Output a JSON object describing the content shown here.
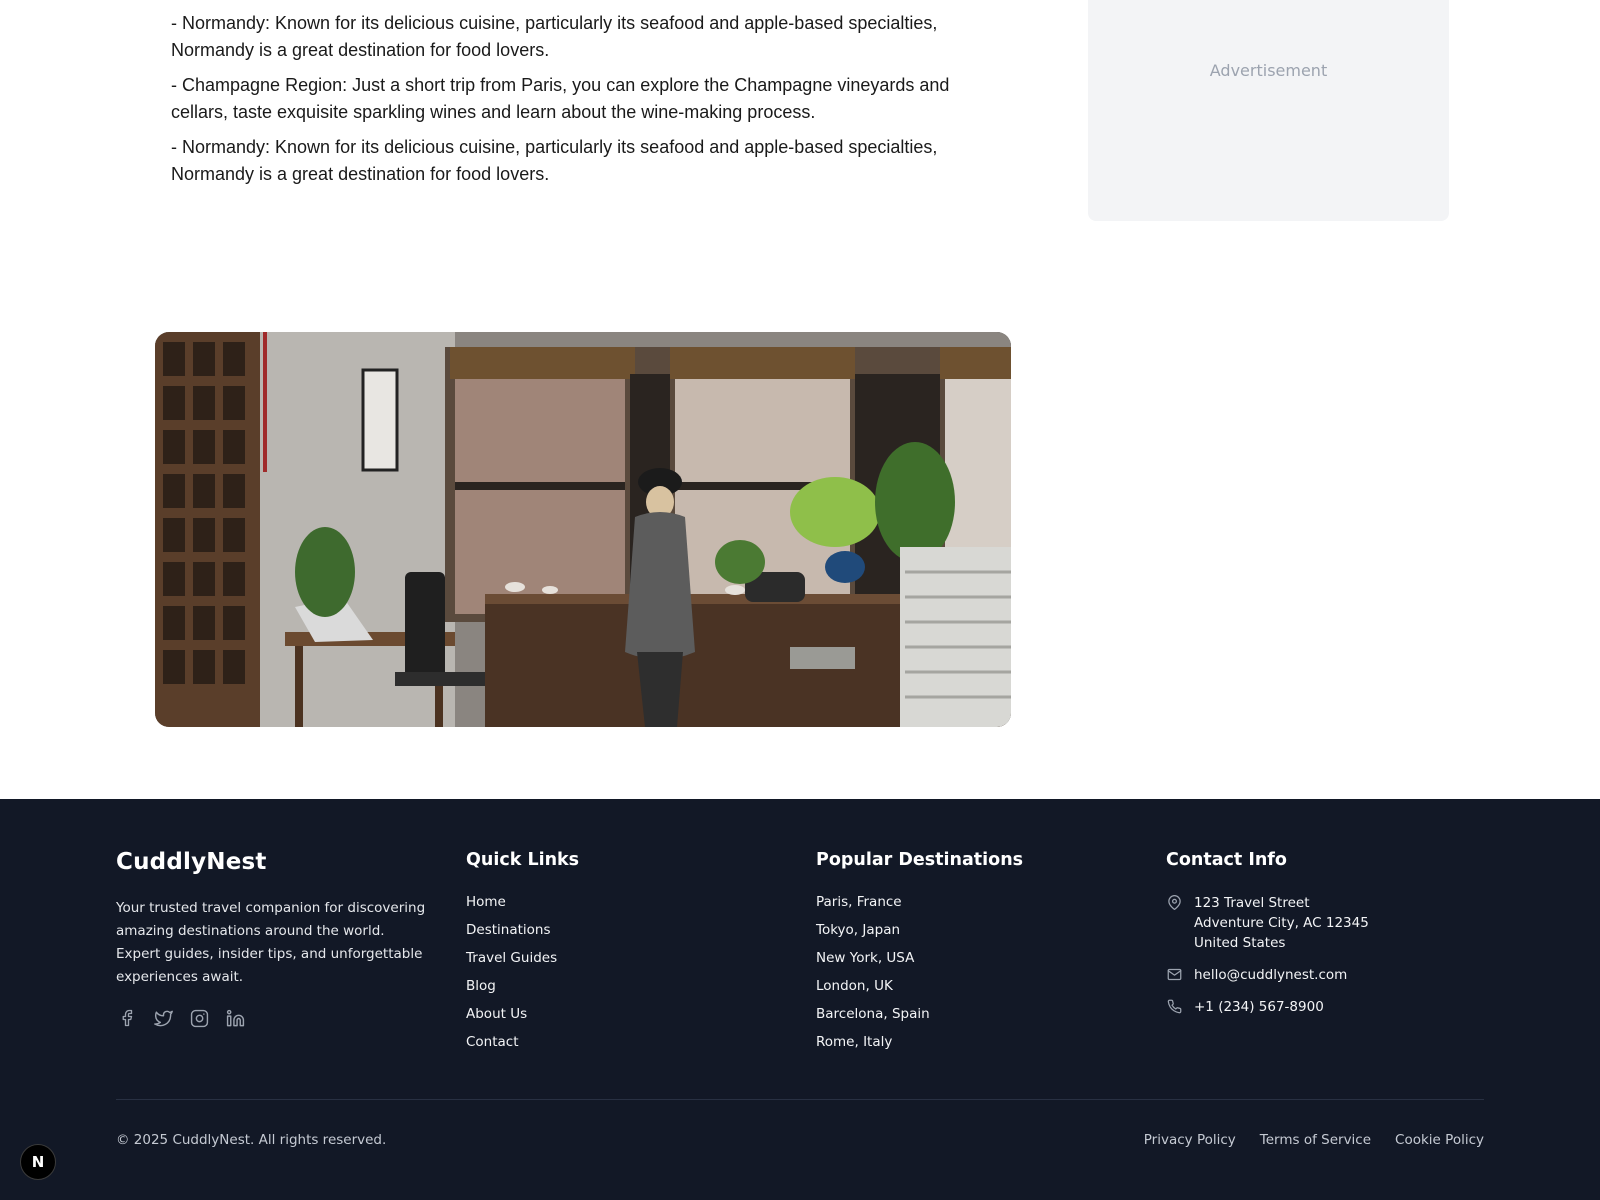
{
  "article": {
    "paragraphs": [
      "- Normandy: Known for its delicious cuisine, particularly its seafood and apple-based specialties, Normandy is a great destination for food lovers.",
      "- Champagne Region: Just a short trip from Paris, you can explore the Champagne vineyards and cellars, taste exquisite sparkling wines and learn about the wine-making process.",
      "- Normandy: Known for its delicious cuisine, particularly its seafood and apple-based specialties, Normandy is a great destination for food lovers."
    ]
  },
  "sidebar": {
    "ad_label": "Advertisement"
  },
  "footer": {
    "brand": "CuddlyNest",
    "description": "Your trusted travel companion for discovering amazing destinations around the world. Expert guides, insider tips, and unforgettable experiences await.",
    "socials": [
      "facebook-icon",
      "twitter-icon",
      "instagram-icon",
      "linkedin-icon"
    ],
    "quick_links": {
      "title": "Quick Links",
      "items": [
        "Home",
        "Destinations",
        "Travel Guides",
        "Blog",
        "About Us",
        "Contact"
      ]
    },
    "popular_destinations": {
      "title": "Popular Destinations",
      "items": [
        "Paris, France",
        "Tokyo, Japan",
        "New York, USA",
        "London, UK",
        "Barcelona, Spain",
        "Rome, Italy"
      ]
    },
    "contact": {
      "title": "Contact Info",
      "address_lines": [
        "123 Travel Street",
        "Adventure City, AC 12345",
        "United States"
      ],
      "email": "hello@cuddlynest.com",
      "phone": "+1 (234) 567-8900"
    },
    "copyright": "© 2025 CuddlyNest. All rights reserved.",
    "legal_links": [
      "Privacy Policy",
      "Terms of Service",
      "Cookie Policy"
    ]
  },
  "dev_badge": {
    "letter": "N"
  },
  "colors": {
    "footer_bg": "#121826",
    "ad_bg": "#f3f4f6",
    "muted_text": "#9ca3af"
  }
}
